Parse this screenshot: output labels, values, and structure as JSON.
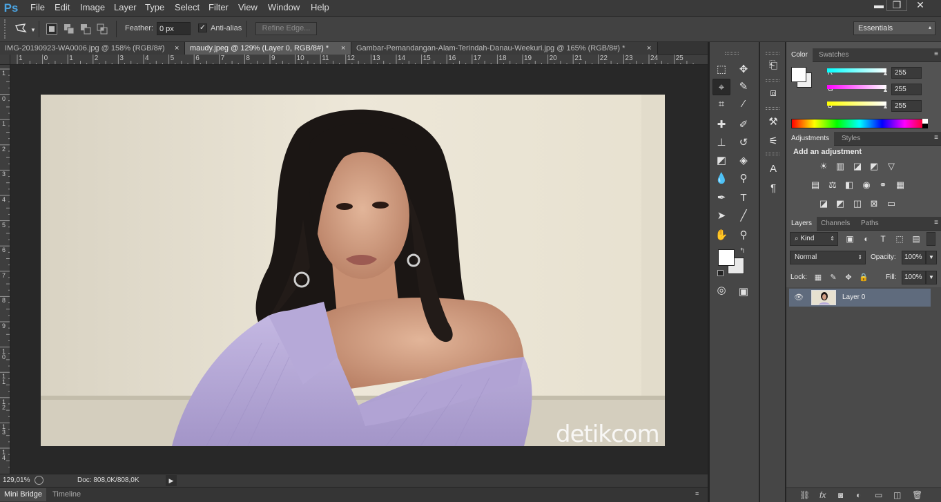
{
  "app": {
    "logo": "Ps"
  },
  "menu": [
    "File",
    "Edit",
    "Image",
    "Layer",
    "Type",
    "Select",
    "Filter",
    "View",
    "Window",
    "Help"
  ],
  "window_controls": {
    "minimize": "▬",
    "restore": "❐",
    "close": "✕"
  },
  "options": {
    "feather_label": "Feather:",
    "feather_value": "0 px",
    "antialias_label": "Anti-alias",
    "antialias_checked": true,
    "refine_edge": "Refine Edge...",
    "workspace": "Essentials"
  },
  "tabs": [
    {
      "label": "IMG-20190923-WA0006.jpg @ 158% (RGB/8#)",
      "close": "×",
      "active": false
    },
    {
      "label": "maudy.jpeg @ 129% (Layer 0, RGB/8#) *",
      "close": "×",
      "active": true
    },
    {
      "label": "Gambar-Pemandangan-Alam-Terindah-Danau-Weekuri.jpg @ 165% (RGB/8#) *",
      "close": "×",
      "active": false
    }
  ],
  "ruler_top": [
    "1",
    "0",
    "1",
    "2",
    "3",
    "4",
    "5",
    "6",
    "7",
    "8",
    "9",
    "10",
    "11",
    "12",
    "13",
    "14",
    "15",
    "16",
    "17",
    "18",
    "19",
    "20",
    "21",
    "22",
    "23",
    "24",
    "25"
  ],
  "ruler_left": [
    "1",
    "0",
    "1",
    "2",
    "3",
    "4",
    "5",
    "6",
    "7",
    "8",
    "9",
    "1 0",
    "1 1",
    "1 2",
    "1 3",
    "1 4"
  ],
  "canvas": {
    "watermark": "detikcom"
  },
  "status": {
    "zoom": "129,01%",
    "doc": "Doc: 808,0K/808,0K"
  },
  "bottom_tabs": [
    "Mini Bridge",
    "Timeline"
  ],
  "color_panel": {
    "tabs": [
      "Color",
      "Swatches"
    ],
    "sliders": [
      {
        "label": "R",
        "value": "255",
        "color": "#33e0e8"
      },
      {
        "label": "G",
        "value": "255",
        "color": "#e233e0"
      },
      {
        "label": "B",
        "value": "255",
        "color": "#f0f020"
      }
    ]
  },
  "adjustments_panel": {
    "tabs": [
      "Adjustments",
      "Styles"
    ],
    "heading": "Add an adjustment"
  },
  "layers_panel": {
    "tabs": [
      "Layers",
      "Channels",
      "Paths"
    ],
    "filter": "Kind",
    "blend_mode": "Normal",
    "opacity_label": "Opacity:",
    "opacity": "100%",
    "lock_label": "Lock:",
    "fill_label": "Fill:",
    "fill": "100%",
    "layers": [
      {
        "name": "Layer 0",
        "visible": true
      }
    ]
  },
  "colors": {
    "accent": "#4ba3e0",
    "selected_layer": "#5f6b7d"
  }
}
